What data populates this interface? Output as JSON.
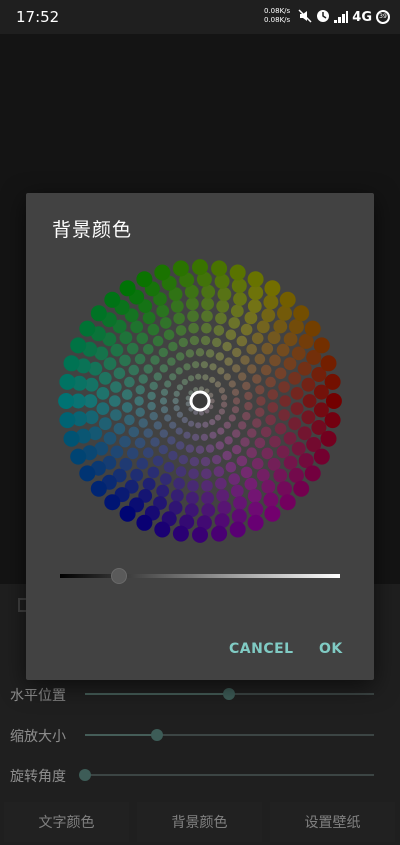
{
  "status_bar": {
    "time": "17:52",
    "net_up": "0.08K/s",
    "net_down": "0.08K/s",
    "network_type": "4G",
    "battery": "39"
  },
  "controls": {
    "rows": [
      {
        "label": "水平位置",
        "value": 0.5
      },
      {
        "label": "缩放大小",
        "value": 0.25
      },
      {
        "label": "旋转角度",
        "value": 0.0
      }
    ],
    "buttons": [
      {
        "label": "文字颜色"
      },
      {
        "label": "背景颜色"
      },
      {
        "label": "设置壁纸"
      }
    ]
  },
  "dialog": {
    "title": "背景颜色",
    "lightness": 0.2,
    "cancel_label": "CANCEL",
    "ok_label": "OK"
  },
  "colors": {
    "accent": "#80cbc4",
    "dialog_bg": "#424242"
  }
}
